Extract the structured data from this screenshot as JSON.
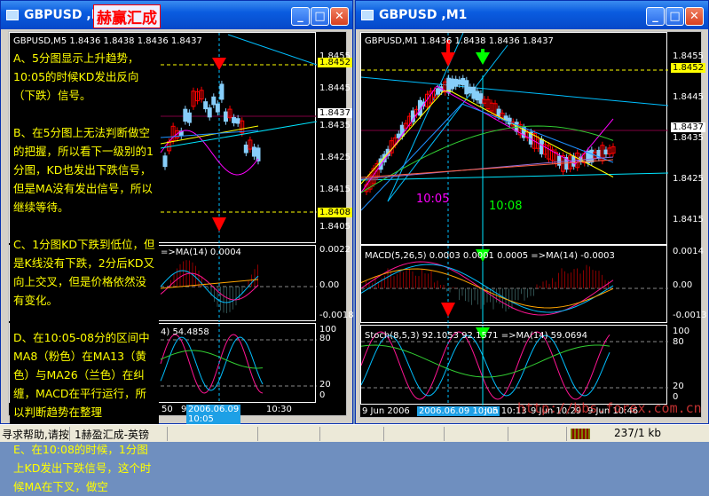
{
  "left_window": {
    "title": "GBPUSD ,M5",
    "stamp": "赫赢汇成",
    "chart_header": "GBPUSD,M5  1.8436 1.8438 1.8436 1.8437",
    "price_axis": [
      "1.8455",
      "1.8445",
      "1.8435",
      "1.8425",
      "1.8415",
      "1.8405"
    ],
    "price_high_tag": "1.8452",
    "price_current_tag": "1.8437",
    "price_low_tag": "1.8408",
    "macd_label": "=>MA(14) 0.0004",
    "macd_axis": [
      "0.0022",
      "0.00",
      "-0.0018"
    ],
    "stoch_label": "4) 54.4858",
    "stoch_axis": [
      "100",
      "80",
      "20",
      "0"
    ],
    "time_axis": [
      "50",
      "9",
      "10:30"
    ],
    "time_cursor": "2006.06.09 10:05",
    "notes": [
      "A、5分图显示上升趋势，10:05的时候KD发出反向（下跌）信号。",
      "B、在5分图上无法判断做空的把握，所以看下一级别的1分图，KD也发出下跌信号，但是MA没有发出信号，所以继续等待。",
      "C、1分图KD下跌到低位，但是K线没有下跌，2分后KD又向上交叉，但是价格依然没有变化。",
      "D、在10:05-08分的区间中MA8（粉色）在MA13（黄色）与MA26（兰色）在纠缠，MACD在平行运行，所以判断趋势在整理",
      "E、在10:08的时候，1分图上KD发出下跌信号，这个时候MA在下叉，做空"
    ]
  },
  "right_window": {
    "title": "GBPUSD ,M1",
    "chart_header": "GBPUSD,M1  1.8436 1.8438 1.8436 1.8437",
    "price_axis": [
      "1.8455",
      "1.8445",
      "1.8435",
      "1.8425",
      "1.8415"
    ],
    "price_high_tag": "1.8452",
    "price_current_tag": "1.8437",
    "marker_1005": "10:05",
    "marker_1008": "10:08",
    "macd_label": "MACD(5,26,5) 0.0003 0.0001 0.0005  =>MA(14) -0.0003",
    "macd_axis": [
      "0.0014",
      "0.00",
      "-0.0013"
    ],
    "stoch_label": "Stoch(8,5,3) 92.1053 92.1571  =>MA(14) 59.0694",
    "stoch_axis": [
      "100",
      "80",
      "20",
      "0"
    ],
    "time_axis": [
      "9 Jun 2006",
      "Jun 10:13",
      "9 Jun 10:29",
      "9 Jun 10:46"
    ],
    "time_cursor": "2006.06.09 10:05",
    "watermark": "http://bbs.forex.com.cn"
  },
  "status_bar": {
    "help": "寻求帮助,请按",
    "profile": "1赫盈汇成-英镑",
    "traffic": "237/1 kb"
  },
  "colors": {
    "up": "#ff0000",
    "down": "#87cefa",
    "ma8": "#ff00ff",
    "ma13": "#ffff00",
    "ma26": "#1e90ff",
    "note_text": "#ffff00"
  }
}
